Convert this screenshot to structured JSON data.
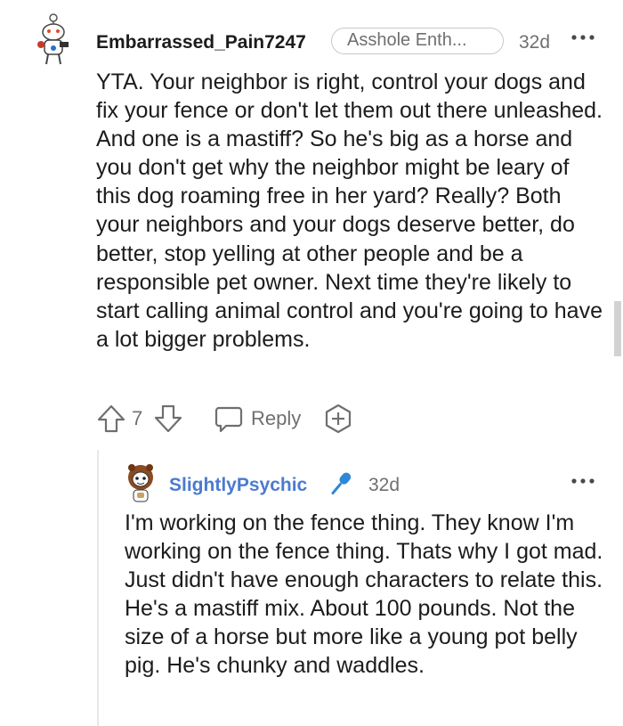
{
  "comment": {
    "username": "Embarrassed_Pain7247",
    "flair": "Asshole Enth...",
    "time": "32d",
    "body": "YTA. Your neighbor is right, control your dogs and fix your fence or don't let them out there unleashed. And one is a mastiff? So he's big as a horse and you don't get why the neighbor might be leary of this dog roaming free in her yard? Really? Both your neighbors and your dogs deserve better, do better, stop yelling at other people and be a responsible pet owner. Next time they're likely to start calling animal control and you're going to have a lot bigger problems.",
    "vote_count": "7",
    "reply_label": "Reply"
  },
  "reply": {
    "username": "SlightlyPsychic",
    "time": "32d",
    "body": "I'm working on the fence thing. They know I'm working on the fence thing. Thats why I got mad. Just didn't have enough characters to relate this. He's a mastiff mix. About 100 pounds. Not the size of a horse but more like a young pot belly pig. He's chunky and waddles."
  },
  "colors": {
    "op_accent": "#4a7bd0",
    "meta_gray": "#6f6f6f"
  },
  "icons": [
    "more-options-icon",
    "upvote-icon",
    "downvote-icon",
    "reply-icon",
    "award-icon",
    "microphone-icon"
  ]
}
